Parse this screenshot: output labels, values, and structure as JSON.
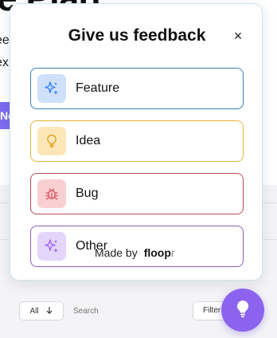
{
  "background": {
    "heading": "e Plan",
    "line1": "ee",
    "line2": "ex",
    "accent_text": "Ne"
  },
  "toolbar": {
    "all_label": "All",
    "search_placeholder": "Search",
    "filter_label": "Filter"
  },
  "panel": {
    "title": "Give us feedback",
    "close_glyph": "×",
    "options": [
      {
        "label": "Feature",
        "icon": "sparkles-icon",
        "border": "#3d7fb8",
        "icon_bg": "#cfe0fb",
        "icon_color": "#3b82f6"
      },
      {
        "label": "Idea",
        "icon": "lightbulb-icon",
        "border": "#e3b53a",
        "icon_bg": "#fde7b8",
        "icon_color": "#e2a21f"
      },
      {
        "label": "Bug",
        "icon": "bug-icon",
        "border": "#b84a55",
        "icon_bg": "#f9cfd2",
        "icon_color": "#e05260"
      },
      {
        "label": "Other",
        "icon": "sparkles-icon",
        "border": "#8f5fb6",
        "icon_bg": "#e4d6fb",
        "icon_color": "#9b6af0"
      }
    ],
    "made_by": "Made by",
    "brand_main": "floop",
    "brand_tail": "r"
  },
  "fab": {
    "icon": "lightbulb-icon",
    "color": "#8b63ee"
  }
}
